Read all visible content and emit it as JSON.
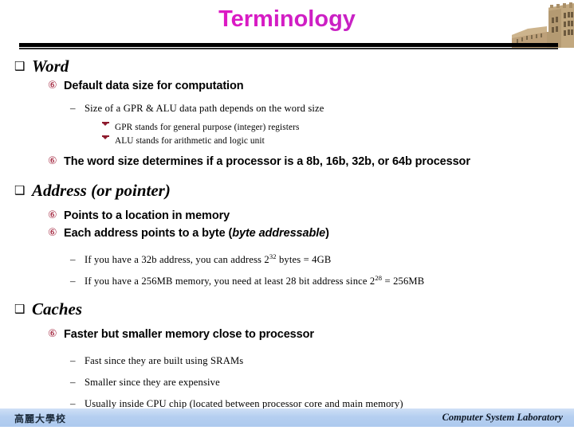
{
  "slide": {
    "title": "Terminology",
    "title_color": "#e012c6",
    "title_color_end": "#9b2fc0",
    "accent_bullet_color": "#9e1b35",
    "divider_color": "#000000"
  },
  "decor": {
    "building_photo_name": "korea-university-main-hall-photo"
  },
  "content": [
    {
      "level": 1,
      "bullet": "❑",
      "text": "Word"
    },
    {
      "level": 2,
      "bullet": "⑥",
      "text": "Default data size for computation"
    },
    {
      "level": 3,
      "bullet": "–",
      "text": "Size of a GPR & ALU data path depends on the word size"
    },
    {
      "level": 4,
      "bullet": "arrow",
      "text": "GPR stands for general purpose (integer) registers"
    },
    {
      "level": 4,
      "bullet": "arrow",
      "text": "ALU stands for arithmetic and logic unit"
    },
    {
      "level": 2,
      "bullet": "⑥",
      "text": "The word size determines if a processor is a 8b, 16b, 32b, or 64b processor"
    },
    {
      "level": 1,
      "bullet": "❑",
      "text": "Address (or pointer)"
    },
    {
      "level": 2,
      "bullet": "⑥",
      "text": "Points to a location in memory"
    },
    {
      "level": 2,
      "bullet": "⑥",
      "text_pre": "Each address points to a byte (",
      "text_italic": "byte addressable",
      "text_post": ")"
    },
    {
      "level": 3,
      "bullet": "–",
      "text_pre": "If you have a 32b address, you can address 2",
      "sup": "32",
      "text_post": " bytes = 4GB"
    },
    {
      "level": 3,
      "bullet": "–",
      "text_pre": "If you have a 256MB memory, you need at least 28 bit address since 2",
      "sup": "28",
      "text_post": " = 256MB"
    },
    {
      "level": 1,
      "bullet": "❑",
      "text": "Caches"
    },
    {
      "level": 2,
      "bullet": "⑥",
      "text": "Faster but smaller memory close to processor"
    },
    {
      "level": 3,
      "bullet": "–",
      "text": "Fast since they are built using SRAMs"
    },
    {
      "level": 3,
      "bullet": "–",
      "text": "Smaller since they are expensive"
    },
    {
      "level": 3,
      "bullet": "–",
      "text": "Usually inside CPU chip (located between processor core and main memory)"
    }
  ],
  "footer": {
    "left": "高麗大學校",
    "right": "Computer System Laboratory",
    "band_color": "#b5cff0"
  }
}
